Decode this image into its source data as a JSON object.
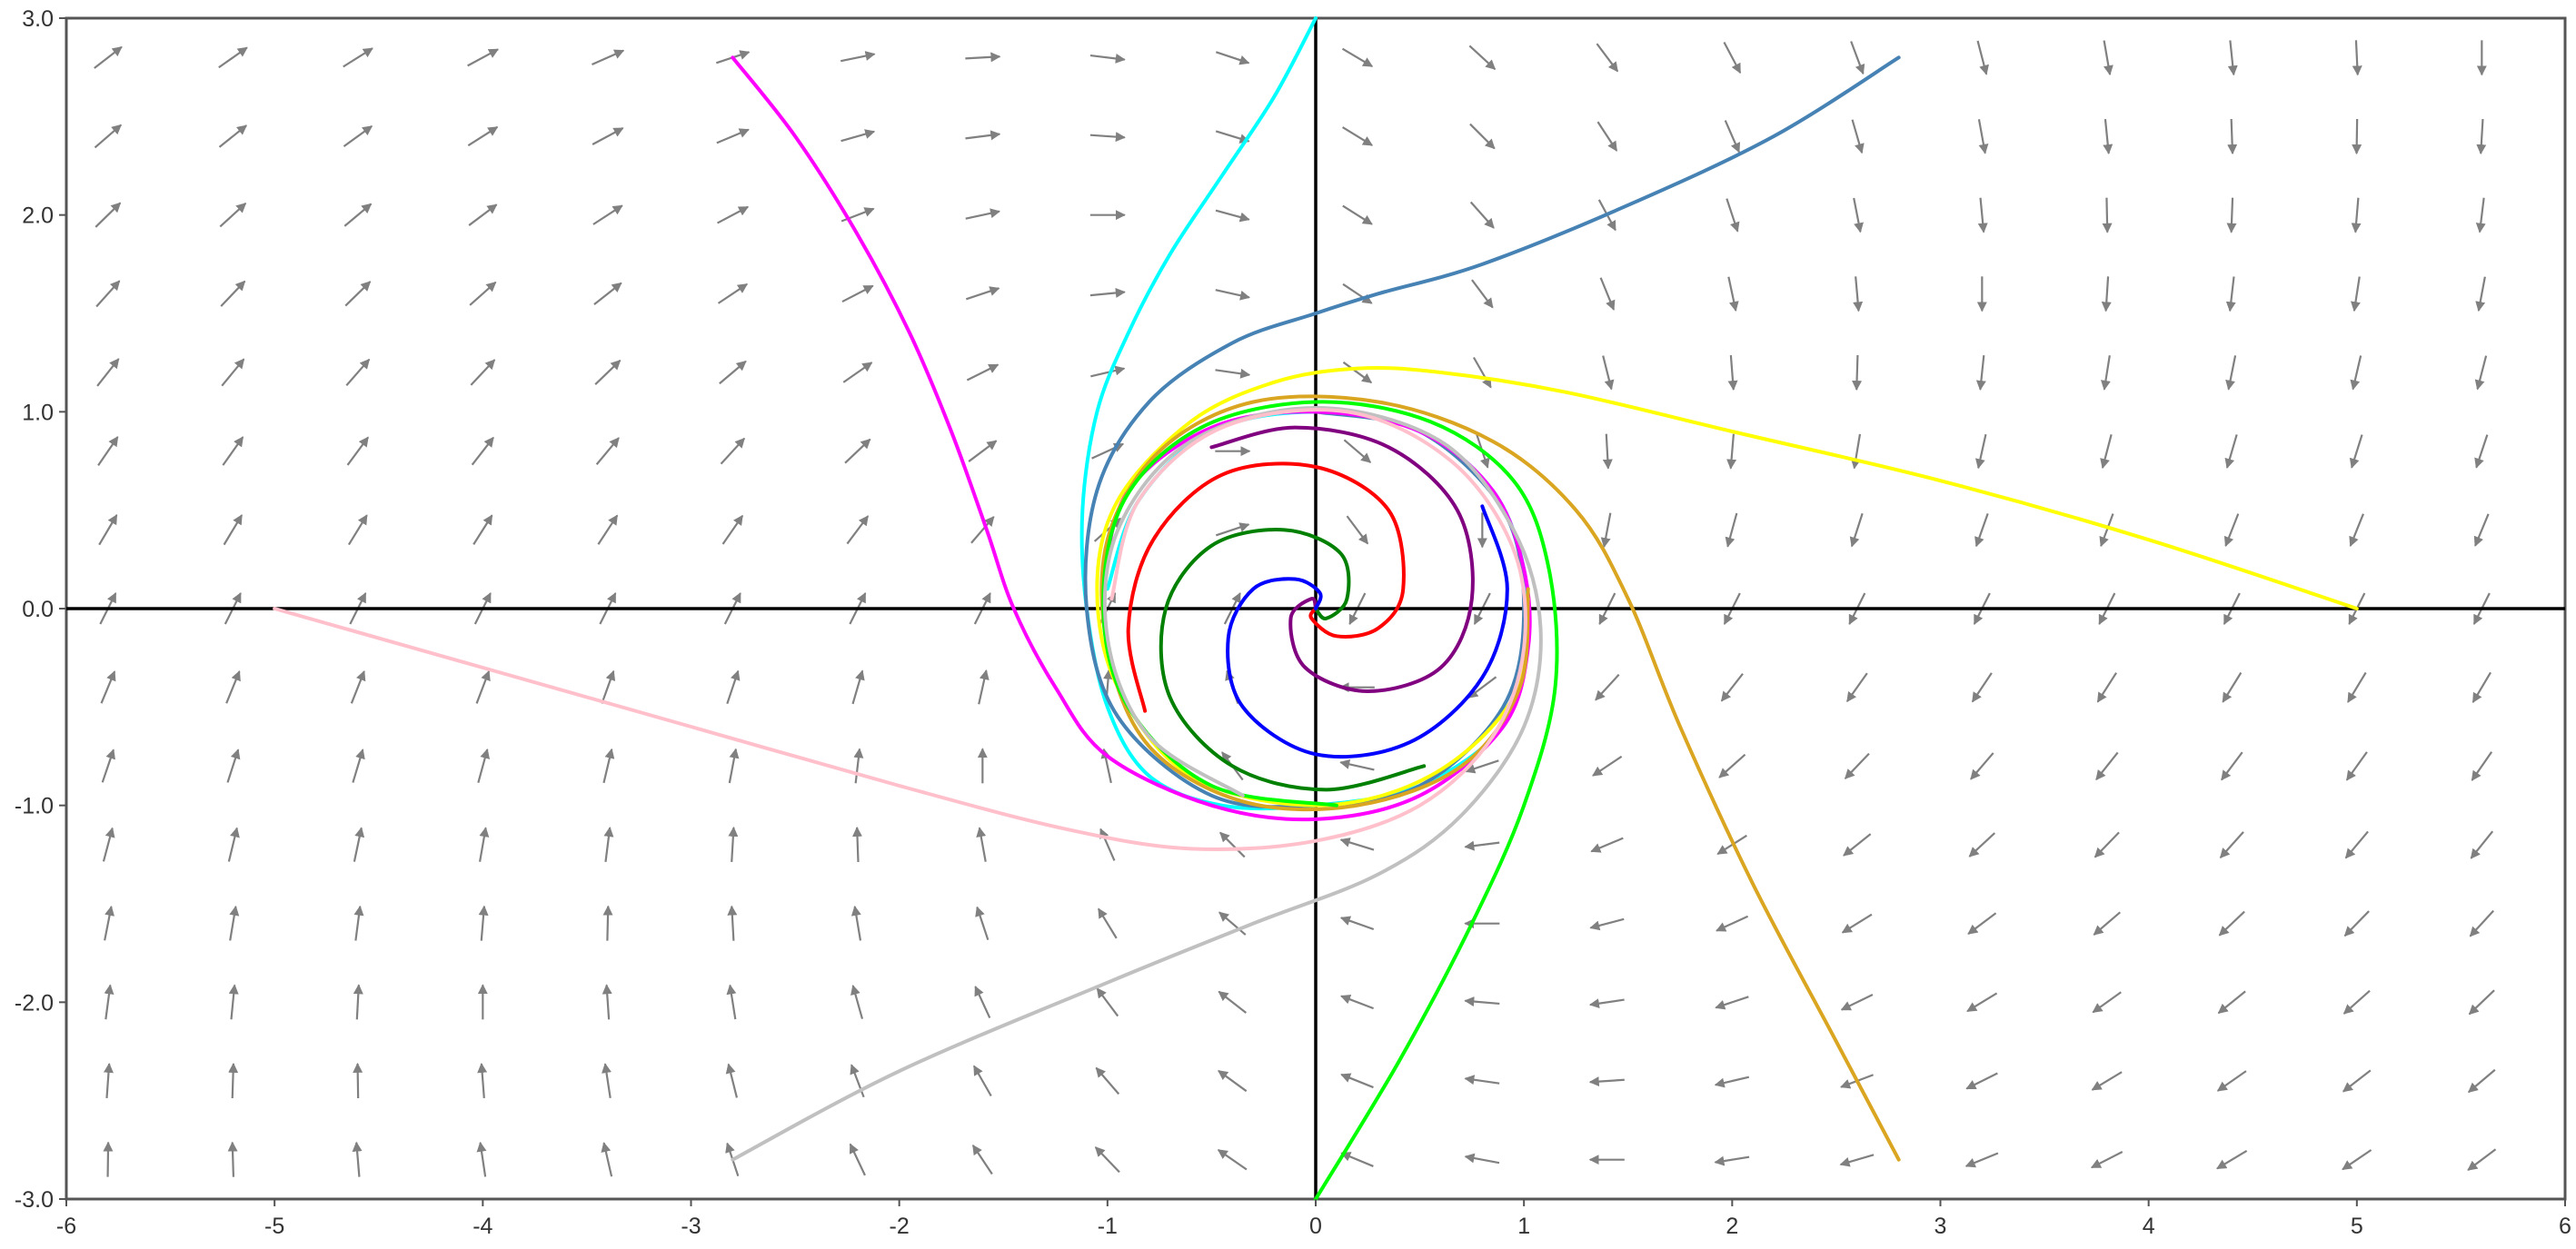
{
  "chart_data": {
    "type": "vector-field",
    "title": "",
    "xlabel": "",
    "ylabel": "",
    "xlim": [
      -6,
      6
    ],
    "ylim": [
      -3,
      3
    ],
    "grid": false,
    "x_ticks": [
      "-6",
      "-5",
      "-4",
      "-3",
      "-2",
      "-1",
      "0",
      "1",
      "2",
      "3",
      "4",
      "5",
      "6"
    ],
    "y_ticks": [
      "-3.0",
      "-2.0",
      "-1.0",
      "0.0",
      "1.0",
      "2.0",
      "3.0"
    ],
    "field": {
      "arrow_color": "#808080",
      "grid_x_start": -5.8,
      "grid_x_end": 5.8,
      "grid_x_step": 0.6,
      "grid_y_start": -2.8,
      "grid_y_end": 2.8,
      "grid_y_step": 0.4
    },
    "series": [
      {
        "color": "#00ffff",
        "points": [
          [
            0,
            3.0
          ],
          [
            -0.2,
            2.6
          ],
          [
            -0.45,
            2.2
          ],
          [
            -0.7,
            1.8
          ],
          [
            -0.9,
            1.4
          ],
          [
            -1.05,
            1.0
          ],
          [
            -1.12,
            0.5
          ],
          [
            -1.1,
            0.0
          ],
          [
            -1.0,
            -0.5
          ],
          [
            -0.8,
            -0.85
          ],
          [
            -0.45,
            -1.0
          ],
          [
            0,
            -1.0
          ],
          [
            0.5,
            -0.9
          ],
          [
            0.9,
            -0.6
          ],
          [
            1.0,
            -0.2
          ],
          [
            1.0,
            0.2
          ],
          [
            0.85,
            0.6
          ],
          [
            0.5,
            0.9
          ],
          [
            0,
            1.0
          ],
          [
            -0.5,
            0.9
          ],
          [
            -0.85,
            0.55
          ],
          [
            -1.0,
            0.1
          ]
        ]
      },
      {
        "color": "#4682b4",
        "points": [
          [
            2.8,
            2.8
          ],
          [
            2.2,
            2.4
          ],
          [
            1.5,
            2.05
          ],
          [
            0.8,
            1.75
          ],
          [
            0.3,
            1.6
          ],
          [
            0,
            1.5
          ],
          [
            -0.4,
            1.35
          ],
          [
            -0.8,
            1.05
          ],
          [
            -1.05,
            0.6
          ],
          [
            -1.1,
            0.0
          ],
          [
            -0.95,
            -0.55
          ],
          [
            -0.5,
            -0.95
          ],
          [
            0,
            -1.0
          ],
          [
            0.5,
            -0.9
          ],
          [
            0.9,
            -0.5
          ],
          [
            1.0,
            0.0
          ],
          [
            0.9,
            0.5
          ],
          [
            0.5,
            0.9
          ],
          [
            0,
            1.0
          ]
        ]
      },
      {
        "color": "#ff00ff",
        "points": [
          [
            -2.8,
            2.8
          ],
          [
            -2.5,
            2.4
          ],
          [
            -2.2,
            1.9
          ],
          [
            -1.95,
            1.4
          ],
          [
            -1.75,
            0.9
          ],
          [
            -1.58,
            0.4
          ],
          [
            -1.45,
            0.0
          ],
          [
            -1.25,
            -0.4
          ],
          [
            -1.0,
            -0.75
          ],
          [
            -0.5,
            -1.0
          ],
          [
            0,
            -1.07
          ],
          [
            0.5,
            -0.95
          ],
          [
            0.9,
            -0.6
          ],
          [
            1.02,
            -0.2
          ],
          [
            1.0,
            0.2
          ],
          [
            0.85,
            0.6
          ],
          [
            0.5,
            0.9
          ],
          [
            0,
            1.0
          ],
          [
            -0.5,
            0.92
          ],
          [
            -0.9,
            0.6
          ],
          [
            -1.02,
            0.15
          ]
        ]
      },
      {
        "color": "#ffff00",
        "points": [
          [
            5.0,
            0.0
          ],
          [
            4.0,
            0.35
          ],
          [
            3.0,
            0.65
          ],
          [
            2.0,
            0.9
          ],
          [
            1.2,
            1.1
          ],
          [
            0.6,
            1.2
          ],
          [
            0.2,
            1.22
          ],
          [
            -0.2,
            1.15
          ],
          [
            -0.6,
            0.95
          ],
          [
            -0.95,
            0.55
          ],
          [
            -1.05,
            0.1
          ],
          [
            -0.95,
            -0.4
          ],
          [
            -0.6,
            -0.85
          ],
          [
            0,
            -1.0
          ],
          [
            0.55,
            -0.85
          ],
          [
            0.95,
            -0.45
          ],
          [
            1.02,
            0.05
          ]
        ]
      },
      {
        "color": "#daa520",
        "points": [
          [
            2.8,
            -2.8
          ],
          [
            2.5,
            -2.2
          ],
          [
            2.1,
            -1.4
          ],
          [
            1.75,
            -0.6
          ],
          [
            1.5,
            0.05
          ],
          [
            1.25,
            0.5
          ],
          [
            0.85,
            0.85
          ],
          [
            0.3,
            1.05
          ],
          [
            -0.3,
            1.05
          ],
          [
            -0.75,
            0.8
          ],
          [
            -1.0,
            0.35
          ],
          [
            -1.0,
            -0.2
          ],
          [
            -0.8,
            -0.7
          ],
          [
            -0.35,
            -0.98
          ],
          [
            0.2,
            -1.0
          ],
          [
            0.7,
            -0.8
          ],
          [
            0.98,
            -0.4
          ],
          [
            1.02,
            0.1
          ]
        ]
      },
      {
        "color": "#00ff00",
        "points": [
          [
            0,
            -3.0
          ],
          [
            0.4,
            -2.3
          ],
          [
            0.75,
            -1.6
          ],
          [
            1.0,
            -1.0
          ],
          [
            1.15,
            -0.4
          ],
          [
            1.12,
            0.2
          ],
          [
            0.95,
            0.65
          ],
          [
            0.55,
            0.95
          ],
          [
            0,
            1.05
          ],
          [
            -0.55,
            0.92
          ],
          [
            -0.92,
            0.55
          ],
          [
            -1.02,
            0.0
          ],
          [
            -0.9,
            -0.5
          ],
          [
            -0.5,
            -0.9
          ],
          [
            0.1,
            -1.0
          ]
        ]
      },
      {
        "color": "#c0c0c0",
        "points": [
          [
            -2.8,
            -2.8
          ],
          [
            -2.0,
            -2.35
          ],
          [
            -1.0,
            -1.9
          ],
          [
            -0.3,
            -1.6
          ],
          [
            0.3,
            -1.35
          ],
          [
            0.7,
            -1.05
          ],
          [
            1.0,
            -0.6
          ],
          [
            1.08,
            -0.1
          ],
          [
            0.95,
            0.4
          ],
          [
            0.6,
            0.85
          ],
          [
            0,
            1.02
          ],
          [
            -0.6,
            0.85
          ],
          [
            -0.95,
            0.4
          ],
          [
            -1.0,
            -0.15
          ],
          [
            -0.8,
            -0.65
          ],
          [
            -0.35,
            -0.95
          ]
        ]
      },
      {
        "color": "#ffc0cb",
        "points": [
          [
            -5.0,
            0.0
          ],
          [
            -4.0,
            -0.3
          ],
          [
            -3.0,
            -0.6
          ],
          [
            -2.0,
            -0.9
          ],
          [
            -1.2,
            -1.12
          ],
          [
            -0.6,
            -1.22
          ],
          [
            0,
            -1.18
          ],
          [
            0.5,
            -1.0
          ],
          [
            0.85,
            -0.65
          ],
          [
            1.0,
            -0.2
          ],
          [
            0.95,
            0.3
          ],
          [
            0.65,
            0.75
          ],
          [
            0.15,
            1.0
          ],
          [
            -0.45,
            0.92
          ],
          [
            -0.85,
            0.55
          ],
          [
            -0.98,
            0.05
          ]
        ]
      },
      {
        "color": "#800080",
        "points": [
          [
            -0.5,
            0.82
          ],
          [
            -0.1,
            0.92
          ],
          [
            0.35,
            0.82
          ],
          [
            0.68,
            0.5
          ],
          [
            0.75,
            0.05
          ],
          [
            0.6,
            -0.3
          ],
          [
            0.25,
            -0.42
          ],
          [
            -0.05,
            -0.3
          ],
          [
            -0.12,
            -0.05
          ],
          [
            -0.02,
            0.05
          ],
          [
            0,
            0
          ]
        ]
      },
      {
        "color": "#ff0000",
        "points": [
          [
            -0.82,
            -0.52
          ],
          [
            -0.9,
            -0.1
          ],
          [
            -0.78,
            0.35
          ],
          [
            -0.45,
            0.68
          ],
          [
            0,
            0.72
          ],
          [
            0.35,
            0.5
          ],
          [
            0.42,
            0.1
          ],
          [
            0.3,
            -0.1
          ],
          [
            0.1,
            -0.14
          ],
          [
            -0.02,
            -0.05
          ],
          [
            0,
            0
          ]
        ]
      },
      {
        "color": "#008000",
        "points": [
          [
            0.52,
            -0.8
          ],
          [
            0.05,
            -0.92
          ],
          [
            -0.4,
            -0.8
          ],
          [
            -0.7,
            -0.45
          ],
          [
            -0.72,
            0.0
          ],
          [
            -0.5,
            0.32
          ],
          [
            -0.15,
            0.4
          ],
          [
            0.12,
            0.28
          ],
          [
            0.15,
            0.05
          ],
          [
            0.05,
            -0.05
          ],
          [
            0,
            0
          ]
        ]
      },
      {
        "color": "#0000ff",
        "points": [
          [
            0.8,
            0.52
          ],
          [
            0.92,
            0.1
          ],
          [
            0.8,
            -0.35
          ],
          [
            0.45,
            -0.68
          ],
          [
            0,
            -0.74
          ],
          [
            -0.35,
            -0.5
          ],
          [
            -0.42,
            -0.15
          ],
          [
            -0.3,
            0.1
          ],
          [
            -0.1,
            0.15
          ],
          [
            0.02,
            0.08
          ],
          [
            0,
            0
          ]
        ]
      }
    ]
  }
}
